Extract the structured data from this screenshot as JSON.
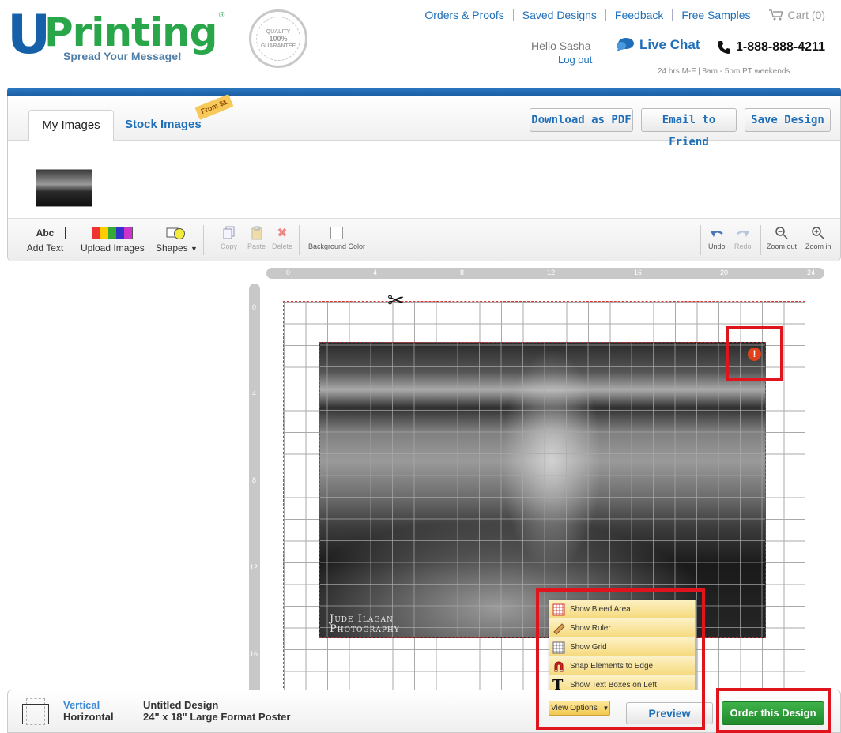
{
  "brand": {
    "logo_u": "U",
    "logo_word": "Printing",
    "logo_reg": "®",
    "tagline": "Spread Your Message!",
    "seal_top": "QUALITY",
    "seal_mid": "100%",
    "seal_bottom": "GUARANTEE",
    "blue": "#1560a8",
    "green": "#2aa64a"
  },
  "header": {
    "links": [
      "Orders & Proofs",
      "Saved Designs",
      "Feedback",
      "Free Samples"
    ],
    "cart": "Cart (0)",
    "hello": "Hello Sasha",
    "logout": "Log out",
    "live_chat": "Live Chat",
    "phone": "1-888-888-4211",
    "hours": "24 hrs M-F | 8am - 5pm PT weekends"
  },
  "tabs": {
    "my_images": "My Images",
    "stock_images": "Stock Images",
    "from_tag": "From $1"
  },
  "actions": {
    "download_pdf": "Download as PDF",
    "email_friend": "Email to Friend",
    "save_design": "Save Design"
  },
  "toolbar": {
    "add_text_icon": "Abc",
    "add_text": "Add Text",
    "upload_images": "Upload Images",
    "shapes": "Shapes",
    "copy": "Copy",
    "paste": "Paste",
    "delete": "Delete",
    "background_color": "Background Color",
    "undo": "Undo",
    "redo": "Redo",
    "zoom_out": "Zoom out",
    "zoom_in": "Zoom in"
  },
  "rulers": {
    "horizontal": [
      "0",
      "4",
      "8",
      "12",
      "16",
      "20",
      "24"
    ],
    "vertical": [
      "0",
      "4",
      "8",
      "12",
      "16"
    ]
  },
  "canvas": {
    "watermark_line1": "Jude Ilagan",
    "watermark_line2": "Photography",
    "alert": "!"
  },
  "view_options": {
    "items": [
      "Show Bleed Area",
      "Show Ruler",
      "Show Grid",
      "Snap Elements to Edge",
      "Show Text Boxes on Left"
    ],
    "button": "View Options"
  },
  "bottom": {
    "vertical": "Vertical",
    "horizontal": "Horizontal",
    "title": "Untitled Design",
    "size": "24\" x 18\" Large Format Poster",
    "preview": "Preview",
    "order": "Order this Design",
    "highlight_color": "#e0141d"
  }
}
